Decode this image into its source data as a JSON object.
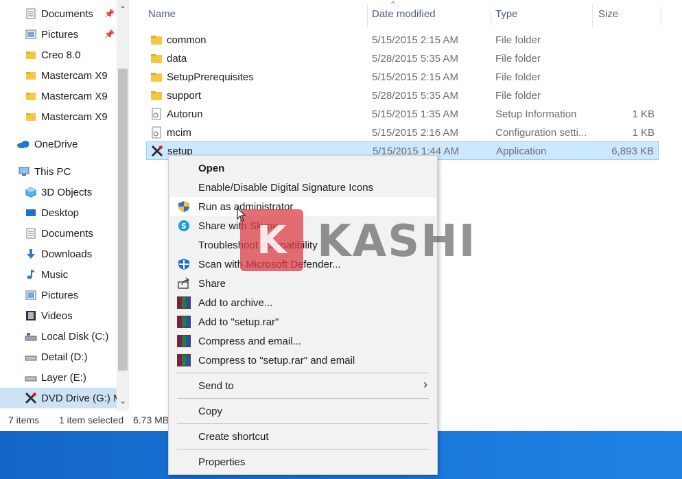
{
  "nav": {
    "items": [
      {
        "label": "Documents",
        "icon": "documents-icon",
        "pinned": true
      },
      {
        "label": "Pictures",
        "icon": "pictures-icon",
        "pinned": true
      },
      {
        "label": "Creo 8.0",
        "icon": "folder-icon"
      },
      {
        "label": "Mastercam X9",
        "icon": "folder-icon"
      },
      {
        "label": "Mastercam X9",
        "icon": "folder-icon"
      },
      {
        "label": "Mastercam X9",
        "icon": "folder-icon"
      },
      {
        "label": "OneDrive",
        "icon": "onedrive-cloud-icon"
      },
      {
        "label": "This PC",
        "icon": "this-pc-icon"
      },
      {
        "label": "3D Objects",
        "icon": "3d-objects-icon"
      },
      {
        "label": "Desktop",
        "icon": "desktop-icon"
      },
      {
        "label": "Documents",
        "icon": "documents-icon"
      },
      {
        "label": "Downloads",
        "icon": "downloads-icon"
      },
      {
        "label": "Music",
        "icon": "music-icon"
      },
      {
        "label": "Pictures",
        "icon": "pictures-icon"
      },
      {
        "label": "Videos",
        "icon": "videos-icon"
      },
      {
        "label": "Local Disk (C:)",
        "icon": "local-disk-icon"
      },
      {
        "label": "Detail (D:)",
        "icon": "drive-icon"
      },
      {
        "label": "Layer (E:)",
        "icon": "drive-icon"
      },
      {
        "label": "DVD Drive (G:) M",
        "icon": "dvd-drive-icon",
        "selected": true
      }
    ]
  },
  "columns": {
    "name": "Name",
    "date": "Date modified",
    "type": "Type",
    "size": "Size"
  },
  "files": [
    {
      "name": "common",
      "date": "5/15/2015 2:15 AM",
      "type": "File folder",
      "size": "",
      "icon": "folder-icon"
    },
    {
      "name": "data",
      "date": "5/28/2015 5:35 AM",
      "type": "File folder",
      "size": "",
      "icon": "folder-icon"
    },
    {
      "name": "SetupPrerequisites",
      "date": "5/15/2015 2:15 AM",
      "type": "File folder",
      "size": "",
      "icon": "folder-icon"
    },
    {
      "name": "support",
      "date": "5/28/2015 5:35 AM",
      "type": "File folder",
      "size": "",
      "icon": "folder-icon"
    },
    {
      "name": "Autorun",
      "date": "5/15/2015 1:35 AM",
      "type": "Setup Information",
      "size": "1 KB",
      "icon": "setup-info-icon"
    },
    {
      "name": "mcim",
      "date": "5/15/2015 2:16 AM",
      "type": "Configuration setti...",
      "size": "1 KB",
      "icon": "config-file-icon"
    },
    {
      "name": "setup",
      "date": "5/15/2015 1:44 AM",
      "type": "Application",
      "size": "6,893 KB",
      "icon": "mastercam-app-icon",
      "selected": true
    }
  ],
  "context_menu": {
    "items": [
      {
        "label": "Open",
        "bold": true
      },
      {
        "label": "Enable/Disable Digital Signature Icons"
      },
      {
        "label": "Run as administrator",
        "icon": "uac-shield-icon",
        "hover": true
      },
      {
        "label": "Share with Skype",
        "icon": "skype-icon"
      },
      {
        "label": "Troubleshoot compatibility"
      },
      {
        "label": "Scan with Microsoft Defender...",
        "icon": "defender-icon"
      },
      {
        "label": "Share",
        "icon": "share-icon"
      },
      {
        "label": "Add to archive...",
        "icon": "winrar-icon"
      },
      {
        "label": "Add to \"setup.rar\"",
        "icon": "winrar-icon"
      },
      {
        "label": "Compress and email...",
        "icon": "winrar-icon"
      },
      {
        "label": "Compress to \"setup.rar\" and email",
        "icon": "winrar-icon"
      },
      {
        "label": "Send to",
        "submenu": true
      },
      {
        "label": "Copy"
      },
      {
        "label": "Create shortcut"
      },
      {
        "label": "Properties"
      }
    ]
  },
  "status": {
    "count": "7 items",
    "selection": "1 item selected",
    "size": "6.73 MB"
  },
  "watermark": {
    "letter": "K",
    "text": "KASHI"
  },
  "colors": {
    "selection": "#cce8ff",
    "nav_selected": "#cde3f5",
    "desktop": "#1875d8"
  }
}
